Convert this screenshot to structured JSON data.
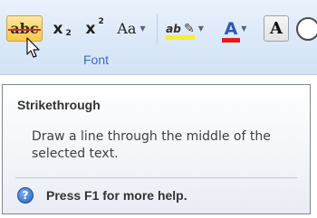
{
  "ribbon": {
    "group_label": "Font",
    "buttons": {
      "strikethrough": "abc",
      "subscript": "x",
      "subscript_mark": "2",
      "superscript": "x",
      "superscript_mark": "2",
      "change_case": "Aa",
      "highlight": "ab",
      "font_color": "A",
      "character_shading": "A"
    },
    "colors": {
      "highlight": "#f8ee2c",
      "font_color": "#e21b1b",
      "active_button": "#ffd86e"
    },
    "icons": [
      "pencil-icon",
      "dropdown-arrow-icon",
      "cursor-arrow-icon",
      "enclosed-character-icon"
    ]
  },
  "tooltip": {
    "title": "Strikethrough",
    "description": "Draw a line through the middle of the selected text.",
    "help_icon_glyph": "?",
    "help_text": "Press F1 for more help."
  }
}
